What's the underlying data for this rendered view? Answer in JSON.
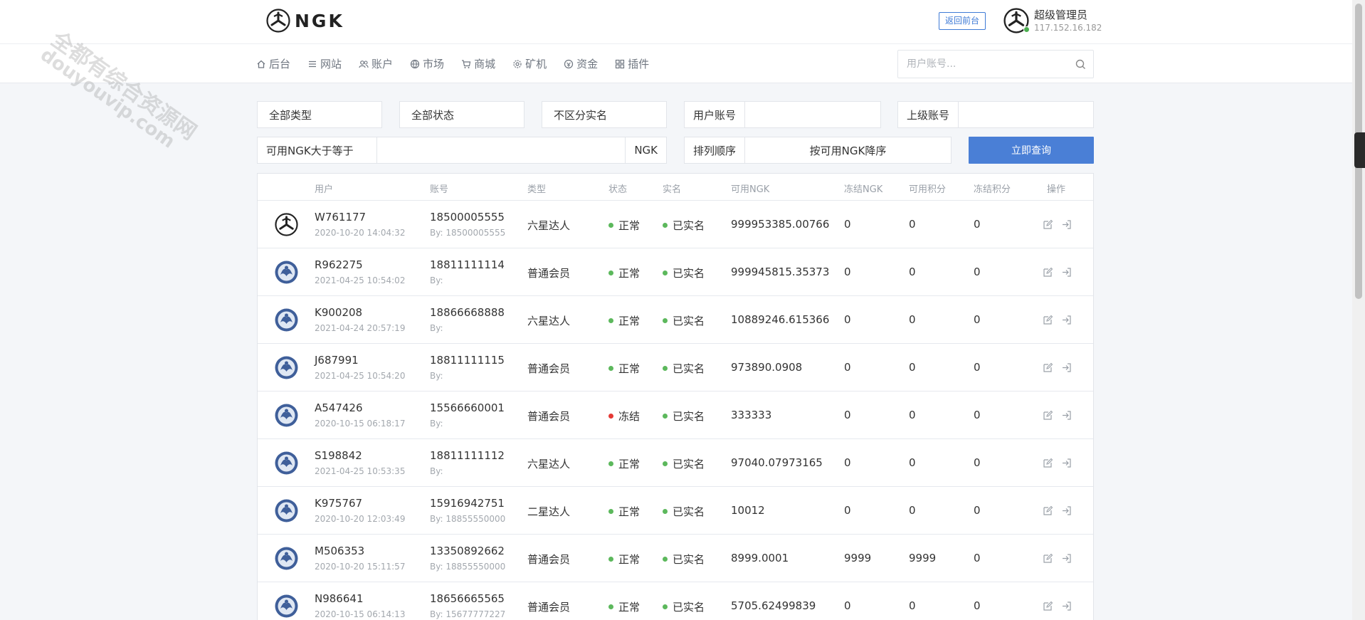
{
  "header": {
    "logo_text": "NGK",
    "back_button": "返回前台",
    "admin_name": "超级管理员",
    "admin_ip": "117.152.16.182"
  },
  "nav": {
    "items": [
      {
        "label": "后台",
        "icon": "home-icon"
      },
      {
        "label": "网站",
        "icon": "list-icon"
      },
      {
        "label": "账户",
        "icon": "users-icon"
      },
      {
        "label": "市场",
        "icon": "globe-icon"
      },
      {
        "label": "商城",
        "icon": "cart-icon"
      },
      {
        "label": "矿机",
        "icon": "gear-icon"
      },
      {
        "label": "资金",
        "icon": "money-icon"
      },
      {
        "label": "插件",
        "icon": "grid-icon"
      }
    ],
    "search_placeholder": "用户账号..."
  },
  "filters": {
    "type": "全部类型",
    "status": "全部状态",
    "realname": "不区分实名",
    "user_account_label": "用户账号",
    "user_account_value": "",
    "parent_account_label": "上级账号",
    "parent_account_value": "",
    "ngk_min_label": "可用NGK大于等于",
    "ngk_min_value": "",
    "ngk_suffix": "NGK",
    "sort_label": "排列顺序",
    "sort_value": "按可用NGK降序",
    "query_button": "立即查询"
  },
  "table": {
    "columns": [
      "用户",
      "账号",
      "类型",
      "状态",
      "实名",
      "可用NGK",
      "冻结NGK",
      "可用积分",
      "冻结积分",
      "操作"
    ],
    "rows": [
      {
        "user": "W761177",
        "date": "2020-10-20 14:04:32",
        "account": "18500005555",
        "by": "By: 18500005555",
        "type": "六星达人",
        "status": "正常",
        "status_color": "#5cb85c",
        "realname": "已实名",
        "ngk": "999953385.00766",
        "frozen_ngk": "0",
        "points": "0",
        "frozen_points": "0",
        "avatar": "ngk-logo"
      },
      {
        "user": "R962275",
        "date": "2021-04-25 10:54:02",
        "account": "18811111114",
        "by": "By:",
        "type": "普通会员",
        "status": "正常",
        "status_color": "#5cb85c",
        "realname": "已实名",
        "ngk": "999945815.35373",
        "frozen_ngk": "0",
        "points": "0",
        "frozen_points": "0",
        "avatar": "blue-avatar"
      },
      {
        "user": "K900208",
        "date": "2021-04-24 20:57:19",
        "account": "18866668888",
        "by": "By:",
        "type": "六星达人",
        "status": "正常",
        "status_color": "#5cb85c",
        "realname": "已实名",
        "ngk": "10889246.615366",
        "frozen_ngk": "0",
        "points": "0",
        "frozen_points": "0",
        "avatar": "blue-avatar"
      },
      {
        "user": "J687991",
        "date": "2021-04-25 10:54:20",
        "account": "18811111115",
        "by": "By:",
        "type": "普通会员",
        "status": "正常",
        "status_color": "#5cb85c",
        "realname": "已实名",
        "ngk": "973890.0908",
        "frozen_ngk": "0",
        "points": "0",
        "frozen_points": "0",
        "avatar": "blue-avatar"
      },
      {
        "user": "A547426",
        "date": "2020-10-15 06:18:17",
        "account": "15566660001",
        "by": "By:",
        "type": "普通会员",
        "status": "冻结",
        "status_color": "#e53935",
        "realname": "已实名",
        "ngk": "333333",
        "frozen_ngk": "0",
        "points": "0",
        "frozen_points": "0",
        "avatar": "blue-avatar"
      },
      {
        "user": "S198842",
        "date": "2021-04-25 10:53:35",
        "account": "18811111112",
        "by": "By:",
        "type": "六星达人",
        "status": "正常",
        "status_color": "#5cb85c",
        "realname": "已实名",
        "ngk": "97040.07973165",
        "frozen_ngk": "0",
        "points": "0",
        "frozen_points": "0",
        "avatar": "blue-avatar"
      },
      {
        "user": "K975767",
        "date": "2020-10-20 12:03:49",
        "account": "15916942751",
        "by": "By: 18855550000",
        "type": "二星达人",
        "status": "正常",
        "status_color": "#5cb85c",
        "realname": "已实名",
        "ngk": "10012",
        "frozen_ngk": "0",
        "points": "0",
        "frozen_points": "0",
        "avatar": "blue-avatar"
      },
      {
        "user": "M506353",
        "date": "2020-10-20 15:11:57",
        "account": "13350892662",
        "by": "By: 18855550000",
        "type": "普通会员",
        "status": "正常",
        "status_color": "#5cb85c",
        "realname": "已实名",
        "ngk": "8999.0001",
        "frozen_ngk": "9999",
        "points": "9999",
        "frozen_points": "0",
        "avatar": "blue-avatar"
      },
      {
        "user": "N986641",
        "date": "2020-10-15 06:14:13",
        "account": "18656665565",
        "by": "By: 15677777227",
        "type": "普通会员",
        "status": "正常",
        "status_color": "#5cb85c",
        "realname": "已实名",
        "ngk": "5705.62499839",
        "frozen_ngk": "0",
        "points": "0",
        "frozen_points": "0",
        "avatar": "blue-avatar"
      }
    ]
  },
  "watermark": {
    "line1": "全都有综合资源网",
    "line2": "douyouvip.com"
  },
  "colors": {
    "accent": "#4a7fd6",
    "ok": "#5cb85c",
    "frozen": "#e53935"
  }
}
